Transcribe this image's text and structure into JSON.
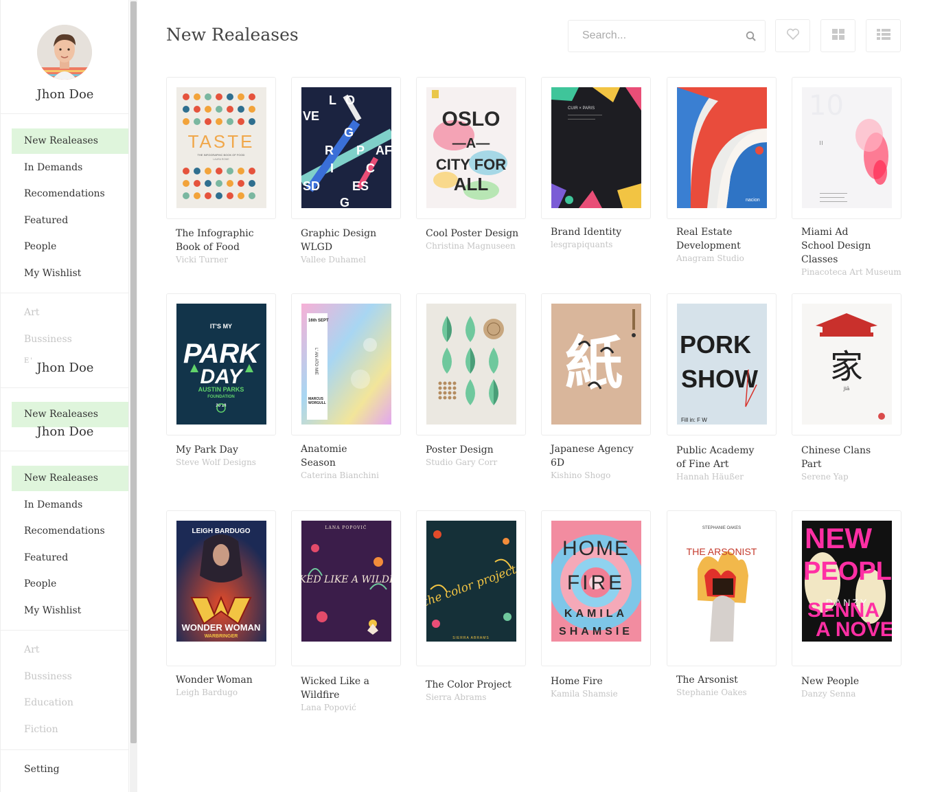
{
  "user": {
    "name": "Jhon Doe"
  },
  "sidebar": {
    "menu1": [
      "New Realeases",
      "In Demands",
      "Recomendations",
      "Featured",
      "People",
      "My Wishlist"
    ],
    "categories1": [
      "Art",
      "Bussiness"
    ],
    "fragment": "E'",
    "dup_name_1": "Jhon Doe",
    "dup_item": "New Realeases",
    "dup_name_2": "Jhon Doe",
    "menu2": [
      "New Realeases",
      "In Demands",
      "Recomendations",
      "Featured",
      "People",
      "My Wishlist"
    ],
    "categories2": [
      "Art",
      "Bussiness",
      "Education",
      "Fiction"
    ],
    "setting": "Setting"
  },
  "header": {
    "title": "New Realeases",
    "search_placeholder": "Search..."
  },
  "icons": {
    "search": "search-icon",
    "wishlist": "heart-icon",
    "grid": "grid-view-icon",
    "list": "list-view-icon"
  },
  "colors": {
    "active_nav": "#dff5dc",
    "muted": "#c6c6c6"
  },
  "books": [
    {
      "title": "The Infographic Book of Food",
      "author": "Vicki Turner"
    },
    {
      "title": "Graphic Design WLGD",
      "author": "Vallee Duhamel"
    },
    {
      "title": "Cool Poster Design",
      "author": "Christina Magnuseen"
    },
    {
      "title": "Brand Identity",
      "author": "lesgrapiquants"
    },
    {
      "title": "Real Estate Development",
      "author": "Anagram Studio"
    },
    {
      "title": "Miami Ad School Design Classes",
      "author": "Pinacoteca Art Museum"
    },
    {
      "title": "My Park Day",
      "author": "Steve Wolf Designs"
    },
    {
      "title": "Anatomie Season",
      "author": "Caterina Bianchini"
    },
    {
      "title": "Poster Design",
      "author": "Studio Gary Corr"
    },
    {
      "title": "Japanese Agency 6D",
      "author": "Kishino Shogo"
    },
    {
      "title": "Public Academy of Fine Art",
      "author": "Hannah Häußer"
    },
    {
      "title": "Chinese Clans Part",
      "author": "Serene Yap"
    },
    {
      "title": "Wonder Woman",
      "author": "Leigh Bardugo"
    },
    {
      "title": "Wicked Like a Wildfire",
      "author": "Lana Popović"
    },
    {
      "title": "The Color Project",
      "author": "Sierra Abrams"
    },
    {
      "title": "Home Fire",
      "author": "Kamila Shamsie"
    },
    {
      "title": "The Arsonist",
      "author": "Stephanie Oakes"
    },
    {
      "title": "New People",
      "author": "Danzy Senna"
    }
  ],
  "covers": {
    "taste": {
      "headline": "TASTE",
      "sub": "THE INFOGRAPHIC BOOK OF FOOD",
      "author": "LAURA ROWE"
    },
    "wlgd": {
      "letters": [
        "L",
        "O",
        "VE",
        "G",
        "R",
        "P",
        "AF",
        "I",
        "C",
        "SD",
        "ES",
        "G"
      ]
    },
    "oslo": {
      "lines": [
        "OSLO",
        "—A—",
        "CITY FOR",
        "ALL"
      ]
    },
    "cuir": {
      "text": "CUIR × PARIS"
    },
    "naelon": {
      "text": "nacion"
    },
    "miami": {
      "text": "10"
    },
    "park": {
      "top": "IT'S MY",
      "l1": "PARK",
      "l2": "DAY",
      "l3": "AUSTIN PARKS",
      "l4": "FOUNDATION",
      "year": "20  18"
    },
    "anatomie": {
      "date": "16th SEPT",
      "vert": "L' AN ATO MIE",
      "name1": "MARCUS",
      "name2": "WORGULL"
    },
    "japan": {
      "glyph": "紙"
    },
    "pork": {
      "l1": "PORK",
      "l2": "SHOW",
      "foot": "Fill in: F W"
    },
    "chinese": {
      "glyph": "家",
      "sub": "jiā"
    },
    "ww": {
      "author": "LEIGH BARDUGO",
      "title": "WONDER WOMAN",
      "sub": "WARBRINGER"
    },
    "wicked": {
      "author": "LANA POPOVIĆ",
      "title": "WICKED LIKE A WILDFIRE"
    },
    "color": {
      "title": "the color project",
      "author": "SIERRA ABRAMS"
    },
    "home": {
      "l1": "HOME",
      "l2": "FIRE",
      "l3": "KAMILA",
      "l4": "SHAMSIE"
    },
    "arson": {
      "author": "STEPHANIE OAKES",
      "title": "THE ARSONIST"
    },
    "newpeople": {
      "l1": "NEW",
      "l2": "PEOPLE",
      "l3": "A NOVEL",
      "l4": "DANZY",
      "l5": "SENNA"
    }
  }
}
